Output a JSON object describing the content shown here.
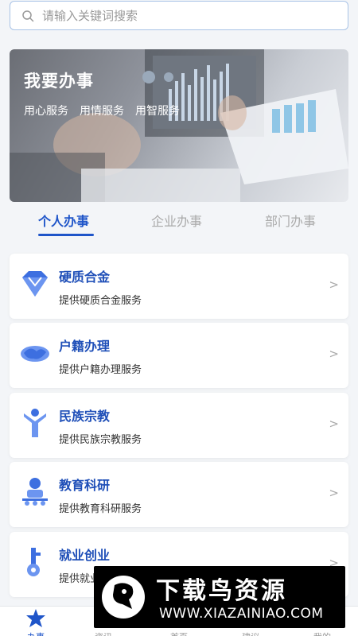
{
  "search": {
    "placeholder": "请输入关键词搜索",
    "icon": "search-icon"
  },
  "banner": {
    "title": "我要办事",
    "tags": [
      "用心服务",
      "用情服务",
      "用智服务"
    ]
  },
  "tabs": [
    {
      "label": "个人办事",
      "active": true
    },
    {
      "label": "企业办事",
      "active": false
    },
    {
      "label": "部门办事",
      "active": false
    }
  ],
  "cards": [
    {
      "title": "硬质合金",
      "desc": "提供硬质合金服务",
      "icon": "diamond-icon",
      "arrow": ">"
    },
    {
      "title": "户籍办理",
      "desc": "提供户籍办理服务",
      "icon": "handshake-icon",
      "arrow": ">"
    },
    {
      "title": "民族宗教",
      "desc": "提供民族宗教服务",
      "icon": "person-icon",
      "arrow": ">"
    },
    {
      "title": "教育科研",
      "desc": "提供教育科研服务",
      "icon": "teacher-icon",
      "arrow": ">"
    },
    {
      "title": "就业创业",
      "desc": "提供就业创业服务",
      "icon": "key-icon",
      "arrow": ">"
    }
  ],
  "bottom_nav": [
    {
      "label": "办事",
      "icon": "star-icon",
      "active": true
    },
    {
      "label": "资讯",
      "icon": "news-icon",
      "active": false
    },
    {
      "label": "首页",
      "icon": "home-icon",
      "active": false
    },
    {
      "label": "建议",
      "icon": "suggest-icon",
      "active": false
    },
    {
      "label": "我的",
      "icon": "user-icon",
      "active": false
    }
  ],
  "watermark": {
    "title": "下载鸟资源",
    "url": "WWW.XIAZAINIAO.COM"
  },
  "colors": {
    "accent": "#1f55c9",
    "icon_blue": "#3d6fe0",
    "background": "#f3f5f8"
  }
}
